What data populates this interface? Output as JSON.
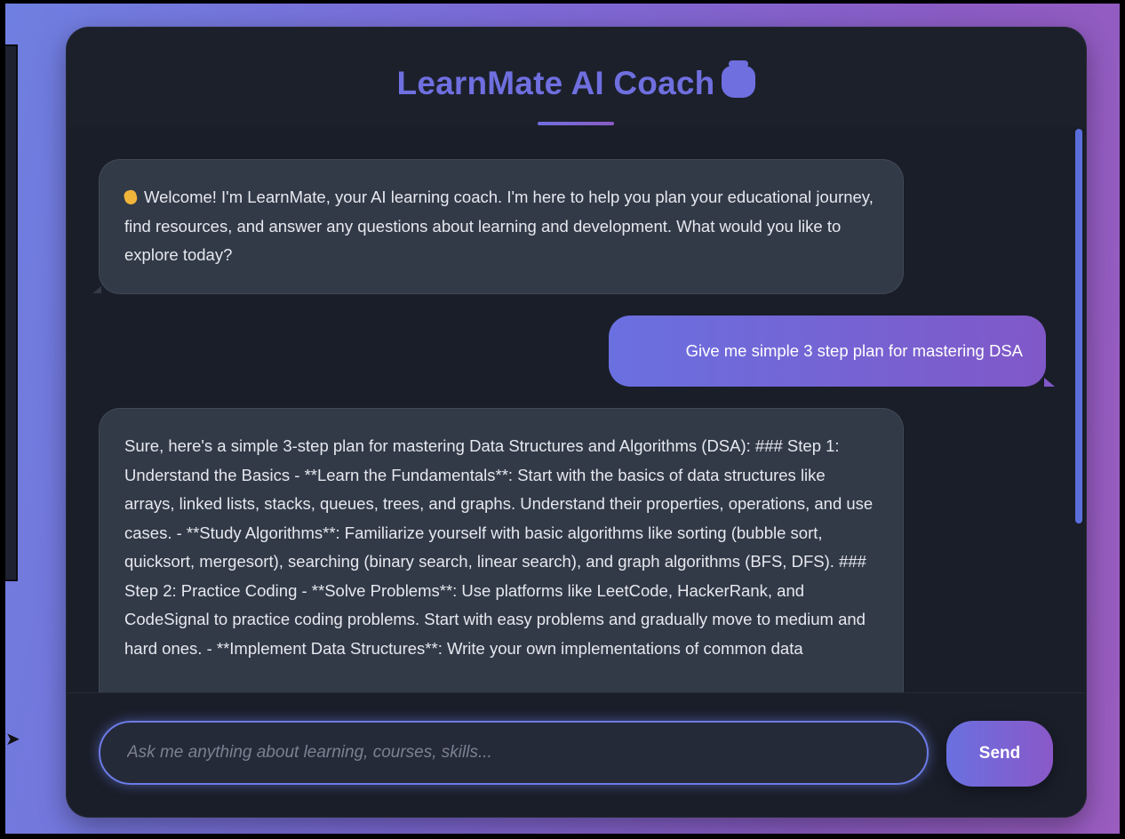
{
  "header": {
    "title": "LearnMate AI Coach",
    "title_icon": "robot-emoji"
  },
  "messages": [
    {
      "role": "assistant",
      "icon": "waving-hand-emoji",
      "text": "Welcome! I'm LearnMate, your AI learning coach. I'm here to help you plan your educational journey, find resources, and answer any questions about learning and development. What would you like to explore today?"
    },
    {
      "role": "user",
      "text": "Give me simple 3 step plan for mastering DSA"
    },
    {
      "role": "assistant",
      "text": "Sure, here's a simple 3-step plan for mastering Data Structures and Algorithms (DSA): ### Step 1: Understand the Basics - **Learn the Fundamentals**: Start with the basics of data structures like arrays, linked lists, stacks, queues, trees, and graphs. Understand their properties, operations, and use cases. - **Study Algorithms**: Familiarize yourself with basic algorithms like sorting (bubble sort, quicksort, mergesort), searching (binary search, linear search), and graph algorithms (BFS, DFS). ### Step 2: Practice Coding - **Solve Problems**: Use platforms like LeetCode, HackerRank, and CodeSignal to practice coding problems. Start with easy problems and gradually move to medium and hard ones. - **Implement Data Structures**: Write your own implementations of common data"
    }
  ],
  "composer": {
    "placeholder": "Ask me anything about learning, courses, skills...",
    "value": "",
    "send_label": "Send"
  },
  "colors": {
    "accent": "#6f6fe0",
    "user_bubble_start": "#6a70e0",
    "user_bubble_end": "#8058c8",
    "card_bg": "#1a1e29",
    "ai_bubble_bg": "#323a48"
  }
}
